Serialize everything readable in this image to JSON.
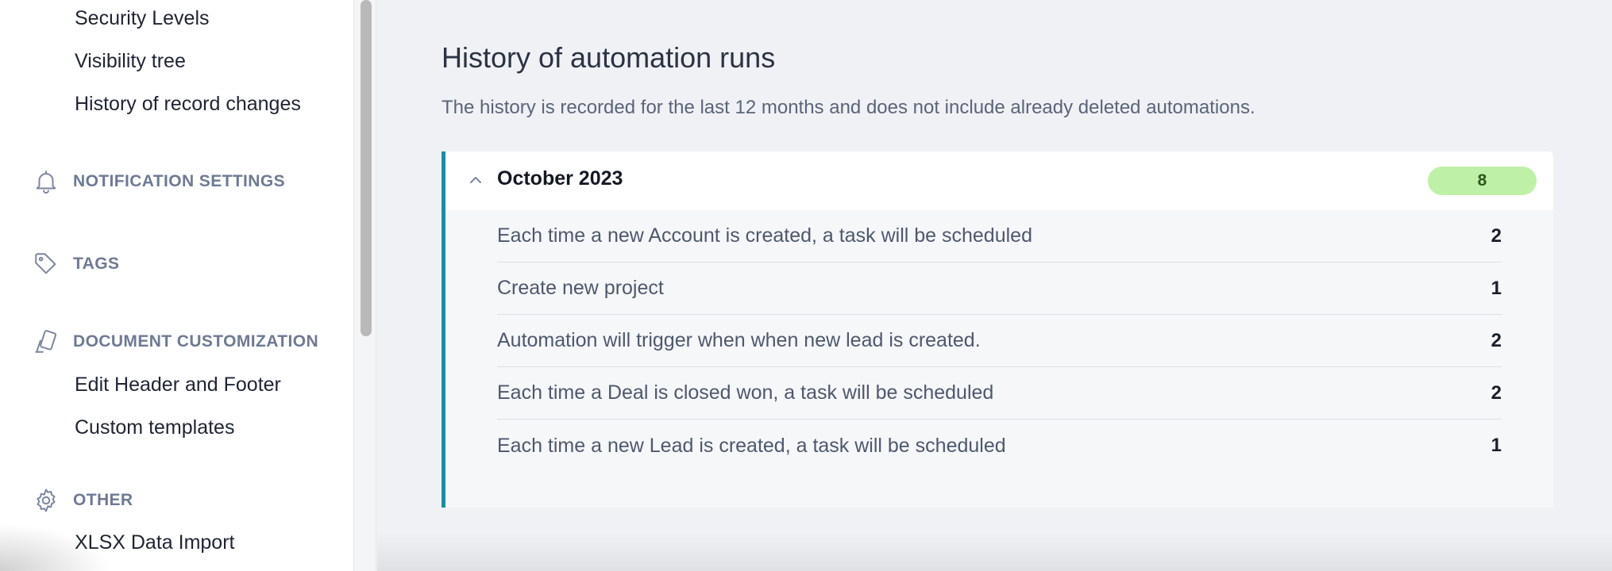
{
  "sidebar": {
    "top_links": [
      "Security Levels",
      "Visibility tree",
      "History of record changes"
    ],
    "sections": {
      "notifications": {
        "label": "NOTIFICATION SETTINGS",
        "icon": "bell-icon"
      },
      "tags": {
        "label": "TAGS",
        "icon": "tag-icon"
      },
      "document": {
        "label": "DOCUMENT CUSTOMIZATION",
        "icon": "document-customization-icon",
        "links": [
          "Edit Header and Footer",
          "Custom templates"
        ]
      },
      "other": {
        "label": "OTHER",
        "icon": "gear-icon",
        "links": [
          "XLSX Data Import"
        ]
      }
    }
  },
  "main": {
    "title": "History of automation runs",
    "subtitle": "The history is recorded for the last 12 months and does not include already deleted automations.",
    "group": {
      "month": "October 2023",
      "total": "8",
      "runs": [
        {
          "name": "Each time a new Account is created, a task will be scheduled",
          "count": "2"
        },
        {
          "name": "Create new project",
          "count": "1"
        },
        {
          "name": "Automation will trigger when when new lead is created.",
          "count": "2"
        },
        {
          "name": "Each time a Deal is closed won, a task will be scheduled",
          "count": "2"
        },
        {
          "name": "Each time a new Lead is created, a task will be scheduled",
          "count": "1"
        }
      ]
    }
  },
  "colors": {
    "accent": "#1a8ea3",
    "badge_bg": "#bff0a8",
    "section_label": "#6d7a94"
  }
}
